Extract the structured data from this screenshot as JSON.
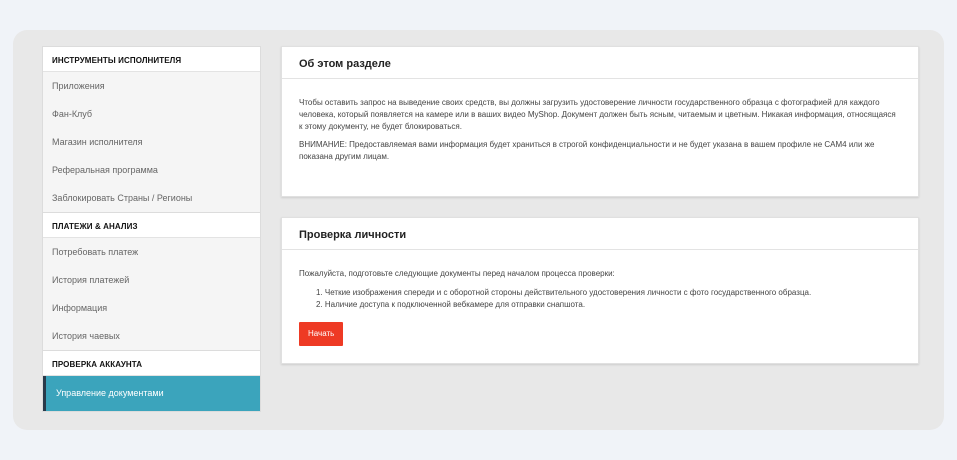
{
  "sidebar": {
    "section1": "ИНСТРУМЕНТЫ ИСПОЛНИТЕЛЯ",
    "section1_items": [
      "Приложения",
      "Фан-Клуб",
      "Магазин исполнителя",
      "Реферальная программа",
      "Заблокировать Страны / Регионы"
    ],
    "section2": "ПЛАТЕЖИ & АНАЛИЗ",
    "section2_items": [
      "Потребовать платеж",
      "История платежей",
      "Информация",
      "История чаевых"
    ],
    "section3": "ПРОВЕРКА АККАУНТА",
    "section3_items": [
      "Управление документами"
    ]
  },
  "about": {
    "title": "Об этом разделе",
    "para1": "Чтобы оставить запрос на выведение своих средств, вы должны загрузить удостоверение личности государственного образца с фотографией для каждого человека, который появляется на камере или в ваших видео MyShop. Документ должен быть ясным, читаемым и цветным. Никакая информация, относящаяся к этому документу, не будет блокироваться.",
    "para2": "ВНИМАНИЕ: Предоставляемая вами информация будет храниться в строгой конфиденциальности и не будет указана в вашем профиле не CAM4 или же показана другим лицам."
  },
  "verify": {
    "title": "Проверка личности",
    "intro": "Пожалуйста, подготовьте следующие документы перед началом процесса проверки:",
    "items": [
      "1. Четкие изображения спереди и с оборотной стороны действительного удостоверения личности с фото государственного образца.",
      "2. Наличие доступа к подключенной вебкамере для отправки снапшота."
    ],
    "button": "Начать"
  },
  "colors": {
    "accent": "#3ba4bc",
    "button": "#ee3a24"
  }
}
